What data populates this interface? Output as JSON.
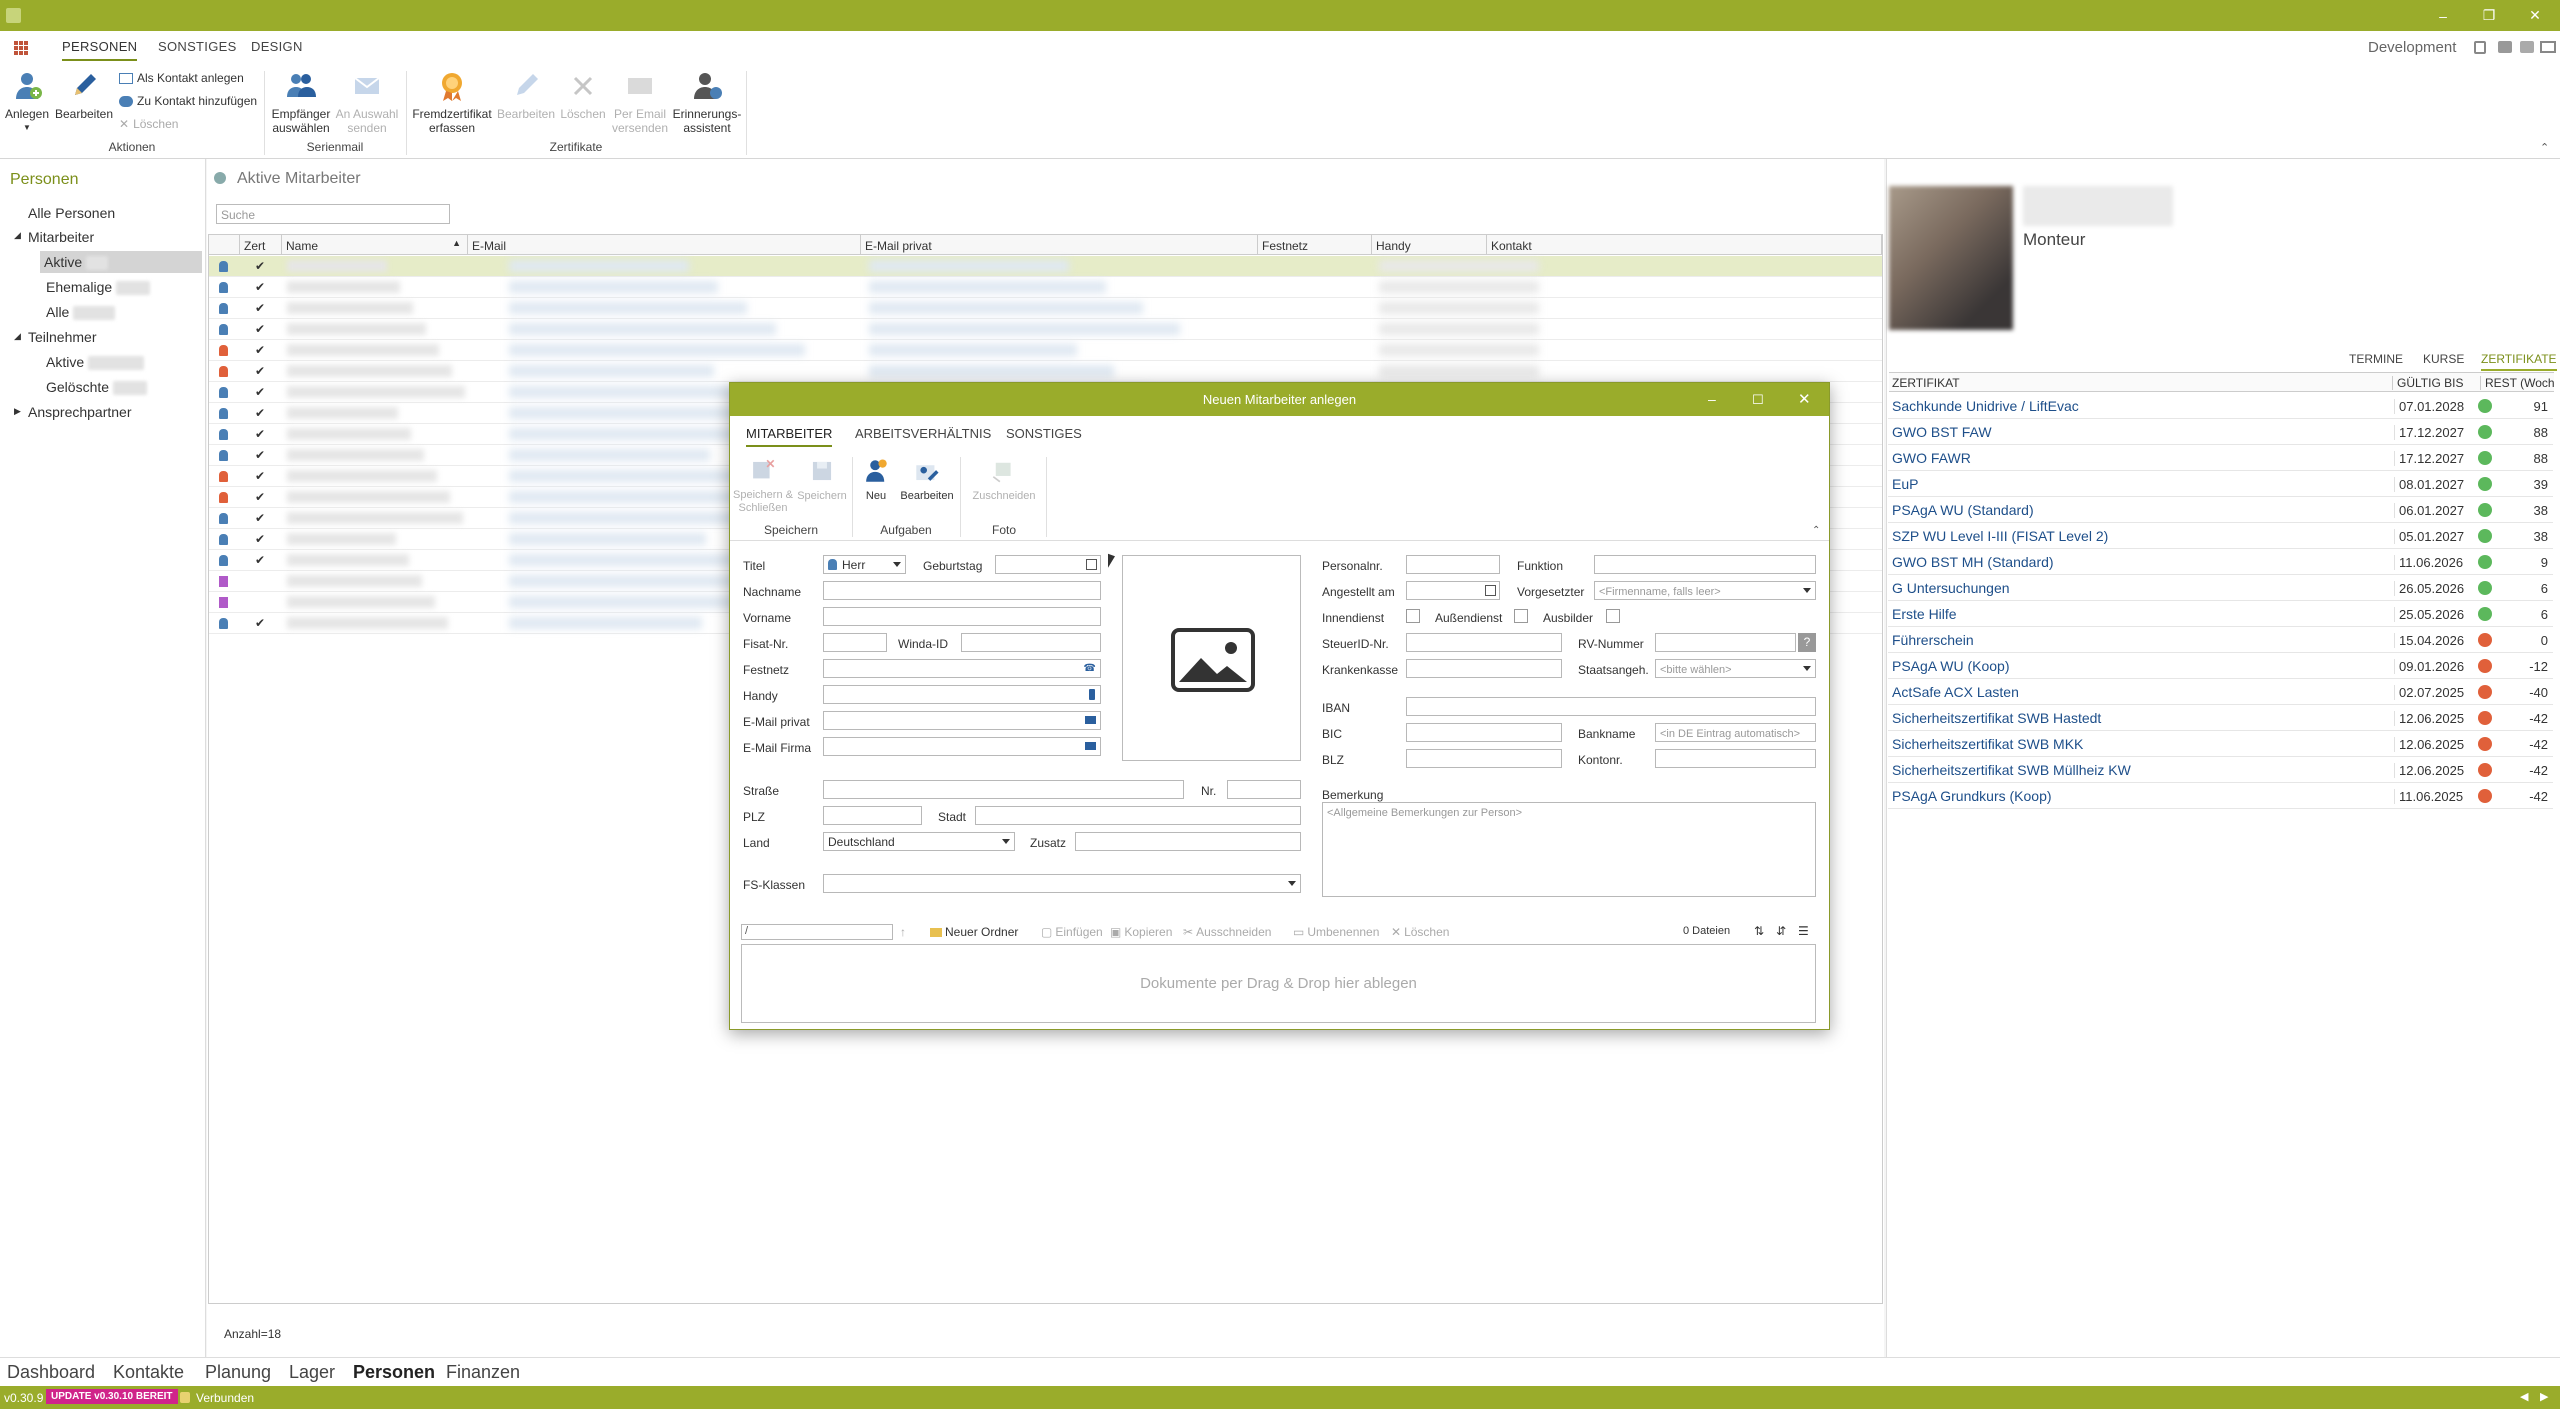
{
  "app": {
    "title_right": "Development",
    "version": "v0.30.9",
    "update_badge": "UPDATE v0.30.10 BEREIT",
    "connection": "Verbunden",
    "accent": "#9aac2b"
  },
  "ribbon": {
    "tabs": [
      "PERSONEN",
      "SONSTIGES",
      "DESIGN"
    ],
    "anlegen": "Anlegen",
    "bearbeiten": "Bearbeiten",
    "als_kontakt": "Als Kontakt anlegen",
    "zu_kontakt": "Zu Kontakt hinzufügen",
    "loeschen": "Löschen",
    "group_aktionen": "Aktionen",
    "empfaenger_1": "Empfänger",
    "empfaenger_2": "auswählen",
    "an_auswahl_1": "An Auswahl",
    "an_auswahl_2": "senden",
    "group_serienmail": "Serienmail",
    "fremd_1": "Fremdzertifikat",
    "fremd_2": "erfassen",
    "z_bearbeiten": "Bearbeiten",
    "z_loeschen": "Löschen",
    "per_email_1": "Per Email",
    "per_email_2": "versenden",
    "erinn_1": "Erinnerungs-",
    "erinn_2": "assistent",
    "group_zertifikate": "Zertifikate"
  },
  "left": {
    "title": "Personen",
    "alle": "Alle Personen",
    "mitarbeiter": "Mitarbeiter",
    "aktive": "Aktive",
    "ehemalige": "Ehemalige",
    "alle_sub": "Alle",
    "teilnehmer": "Teilnehmer",
    "t_aktive": "Aktive",
    "geloeschte": "Gelöschte",
    "ansprech": "Ansprechpartner"
  },
  "center": {
    "title": "Aktive Mitarbeiter",
    "search_placeholder": "Suche",
    "columns": [
      "Zert",
      "Name",
      "E-Mail",
      "E-Mail privat",
      "Festnetz",
      "Handy",
      "Kontakt"
    ],
    "count": "Anzahl=18"
  },
  "right": {
    "role": "Monteur",
    "tabs": [
      "TERMINE",
      "KURSE",
      "ZERTIFIKATE"
    ],
    "col_zert": "ZERTIFIKAT",
    "col_gueltig": "GÜLTIG BIS",
    "col_rest": "REST (Woch...",
    "certs": [
      {
        "name": "Sachkunde Unidrive / LiftEvac",
        "date": "07.01.2028",
        "rest": "91",
        "status": "green"
      },
      {
        "name": "GWO BST FAW",
        "date": "17.12.2027",
        "rest": "88",
        "status": "green"
      },
      {
        "name": "GWO FAWR",
        "date": "17.12.2027",
        "rest": "88",
        "status": "green"
      },
      {
        "name": "EuP",
        "date": "08.01.2027",
        "rest": "39",
        "status": "green"
      },
      {
        "name": "PSAgA WU (Standard)",
        "date": "06.01.2027",
        "rest": "38",
        "status": "green"
      },
      {
        "name": "SZP WU Level I-III (FISAT Level 2)",
        "date": "05.01.2027",
        "rest": "38",
        "status": "green"
      },
      {
        "name": "GWO BST MH (Standard)",
        "date": "11.06.2026",
        "rest": "9",
        "status": "green"
      },
      {
        "name": "G Untersuchungen",
        "date": "26.05.2026",
        "rest": "6",
        "status": "green"
      },
      {
        "name": "Erste Hilfe",
        "date": "25.05.2026",
        "rest": "6",
        "status": "green"
      },
      {
        "name": "Führerschein",
        "date": "15.04.2026",
        "rest": "0",
        "status": "red"
      },
      {
        "name": "PSAgA WU (Koop)",
        "date": "09.01.2026",
        "rest": "-12",
        "status": "red"
      },
      {
        "name": "ActSafe ACX Lasten",
        "date": "02.07.2025",
        "rest": "-40",
        "status": "red"
      },
      {
        "name": "Sicherheitszertifikat SWB Hastedt",
        "date": "12.06.2025",
        "rest": "-42",
        "status": "red"
      },
      {
        "name": "Sicherheitszertifikat SWB MKK",
        "date": "12.06.2025",
        "rest": "-42",
        "status": "red"
      },
      {
        "name": "Sicherheitszertifikat SWB Müllheiz KW",
        "date": "12.06.2025",
        "rest": "-42",
        "status": "red"
      },
      {
        "name": "PSAgA Grundkurs (Koop)",
        "date": "11.06.2025",
        "rest": "-42",
        "status": "red"
      }
    ],
    "green": "#5cb85c",
    "red": "#e0603a"
  },
  "bottomnav": [
    "Dashboard",
    "Kontakte",
    "Planung",
    "Lager",
    "Personen",
    "Finanzen"
  ],
  "dialog": {
    "title": "Neuen Mitarbeiter anlegen",
    "tabs": [
      "MITARBEITER",
      "ARBEITSVERHÄLTNIS",
      "SONSTIGES"
    ],
    "speichern_schliessen_1": "Speichern &",
    "speichern_schliessen_2": "Schließen",
    "speichern": "Speichern",
    "group_speichern": "Speichern",
    "neu": "Neu",
    "bearbeiten": "Bearbeiten",
    "group_aufgaben": "Aufgaben",
    "zuschneiden": "Zuschneiden",
    "group_foto": "Foto",
    "labels": {
      "titel": "Titel",
      "geburtstag": "Geburtstag",
      "nachname": "Nachname",
      "vorname": "Vorname",
      "fisat": "Fisat-Nr.",
      "winda": "Winda-ID",
      "festnetz": "Festnetz",
      "handy": "Handy",
      "email_privat": "E-Mail privat",
      "email_firma": "E-Mail Firma",
      "strasse": "Straße",
      "nr": "Nr.",
      "plz": "PLZ",
      "stadt": "Stadt",
      "land": "Land",
      "zusatz": "Zusatz",
      "fs_klassen": "FS-Klassen",
      "personalnr": "Personalnr.",
      "funktion": "Funktion",
      "angestellt": "Angestellt am",
      "vorgesetzter": "Vorgesetzter",
      "innendienst": "Innendienst",
      "aussendienst": "Außendienst",
      "ausbilder": "Ausbilder",
      "steuerid": "SteuerID-Nr.",
      "rvnummer": "RV-Nummer",
      "krankenkasse": "Krankenkasse",
      "staatsangeh": "Staatsangeh.",
      "iban": "IBAN",
      "bic": "BIC",
      "bankname": "Bankname",
      "blz": "BLZ",
      "kontonr": "Kontonr.",
      "bemerkung": "Bemerkung"
    },
    "values": {
      "titel": "Herr",
      "land": "Deutschland",
      "vorgesetzter_ph": "<Firmenname, falls leer>",
      "staatsangeh_ph": "<bitte wählen>",
      "bankname_ph": "<in DE Eintrag automatisch>",
      "bemerkung_ph": "<Allgemeine Bemerkungen zur Person>"
    },
    "files": {
      "path": "/",
      "neuer_ordner": "Neuer Ordner",
      "einfuegen": "Einfügen",
      "kopieren": "Kopieren",
      "ausschneiden": "Ausschneiden",
      "umbenennen": "Umbenennen",
      "loeschen": "Löschen",
      "count": "0 Dateien",
      "drop_hint": "Dokumente per Drag & Drop hier ablegen"
    }
  }
}
